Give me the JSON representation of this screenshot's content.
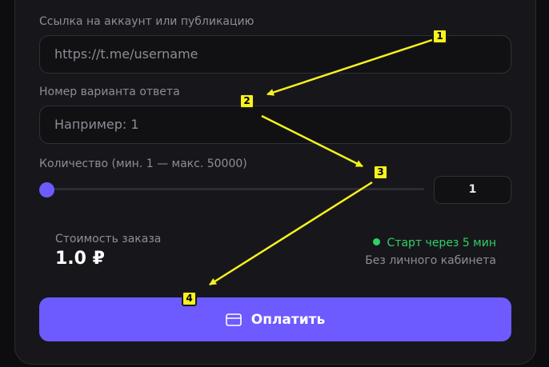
{
  "form": {
    "link_label": "Ссылка на аккаунт или публикацию",
    "link_placeholder": "https://t.me/username",
    "variant_label": "Номер варианта ответа",
    "variant_placeholder": "Например: 1",
    "quantity_label": "Количество (мин. 1 — макс. 50000)",
    "quantity_value": "1",
    "quantity_slider_value": 1,
    "quantity_min": 1,
    "quantity_max": 50000
  },
  "order": {
    "cost_label": "Стоимость заказа",
    "cost_value": "1.0 ₽",
    "start_text": "Старт через 5 мин",
    "no_cabinet_text": "Без личного кабинета"
  },
  "pay_button": {
    "label": "Оплатить",
    "icon": "credit-card-icon"
  },
  "annotations": [
    {
      "number": "1"
    },
    {
      "number": "2"
    },
    {
      "number": "3"
    },
    {
      "number": "4"
    }
  ],
  "colors": {
    "accent": "#6d5bff",
    "status_green": "#2fd067",
    "annotation_yellow": "#f8f21d"
  }
}
